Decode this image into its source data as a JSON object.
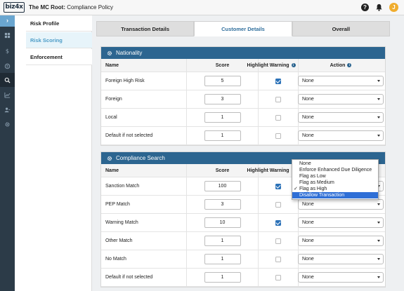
{
  "app": {
    "logo": "biz4x",
    "title_bold": "The MC Root:",
    "title_rest": " Compliance Policy"
  },
  "topbar_icons": [
    "help-icon",
    "bell-icon",
    "user-icon"
  ],
  "user_badge": "J",
  "help_glyph": "?",
  "rail": {
    "toggle": "›",
    "items": [
      "dashboard-icon",
      "dollar-icon",
      "exchange-icon",
      "search-icon",
      "chart-icon",
      "users-icon",
      "gear-icon"
    ]
  },
  "subnav": [
    {
      "label": "Risk Profile",
      "active": false
    },
    {
      "label": "Risk Scoring",
      "active": true
    },
    {
      "label": "Enforcement",
      "active": false
    }
  ],
  "tabs": [
    {
      "label": "Transaction Details",
      "active": false
    },
    {
      "label": "Customer Details",
      "active": true
    },
    {
      "label": "Overall",
      "active": false
    }
  ],
  "columns": {
    "name": "Name",
    "score": "Score",
    "highlight": "Highlight Warning",
    "action": "Action"
  },
  "nationality": {
    "title": "Nationality",
    "rows": [
      {
        "name": "Foreign High Risk",
        "score": "5",
        "highlight": true,
        "action": "None"
      },
      {
        "name": "Foreign",
        "score": "3",
        "highlight": false,
        "action": "None"
      },
      {
        "name": "Local",
        "score": "1",
        "highlight": false,
        "action": "None"
      },
      {
        "name": "Default if not selected",
        "score": "1",
        "highlight": false,
        "action": "None"
      }
    ]
  },
  "compliance": {
    "title": "Compliance Search",
    "rows": [
      {
        "name": "Sanction Match",
        "score": "100",
        "highlight": true,
        "action": "None"
      },
      {
        "name": "PEP Match",
        "score": "3",
        "highlight": false,
        "action": "None"
      },
      {
        "name": "Warning Match",
        "score": "10",
        "highlight": true,
        "action": "None"
      },
      {
        "name": "Other Match",
        "score": "1",
        "highlight": false,
        "action": "None"
      },
      {
        "name": "No Match",
        "score": "1",
        "highlight": false,
        "action": "None"
      },
      {
        "name": "Default if not selected",
        "score": "1",
        "highlight": false,
        "action": "None"
      }
    ]
  },
  "dropdown": {
    "options": [
      "None",
      "Enforce Enhanced Due Diligence",
      "Flag as Low",
      "Flag as Medium",
      "Flag as High",
      "Disallow Transaction"
    ],
    "checked_index": 4,
    "highlighted_index": 5,
    "tick": "✓"
  },
  "colors": {
    "panel_header": "#2c6590",
    "rail": "#2c3b48",
    "active_tab_text": "#2f6e9c",
    "checkbox_on": "#2c72b8",
    "dropdown_highlight": "#2f6fd6"
  }
}
